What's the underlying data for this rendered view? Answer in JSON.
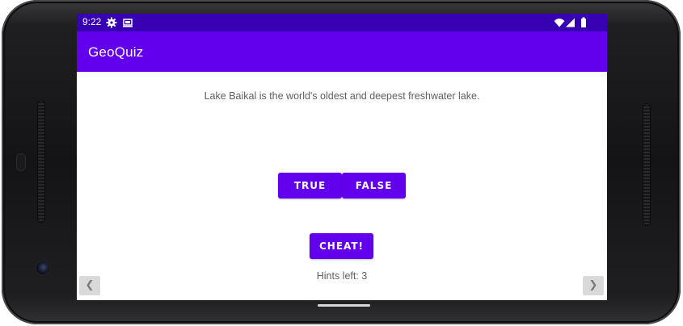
{
  "status_bar": {
    "time": "9:22",
    "left_icons": [
      "gear-icon",
      "cast-icon"
    ],
    "right_icons": [
      "wifi-icon",
      "signal-icon",
      "battery-icon"
    ]
  },
  "app_bar": {
    "title": "GeoQuiz"
  },
  "quiz": {
    "question": "Lake Baikal is the world's oldest and deepest freshwater lake.",
    "true_label": "TRUE",
    "false_label": "FALSE",
    "cheat_label": "CHEAT!",
    "hints_text": "Hints left: 3"
  },
  "navigation": {
    "prev_glyph": "❮",
    "next_glyph": "❯"
  },
  "colors": {
    "status_bar": "#3700b3",
    "primary": "#6200ee",
    "text_secondary": "#5f5f5f"
  }
}
